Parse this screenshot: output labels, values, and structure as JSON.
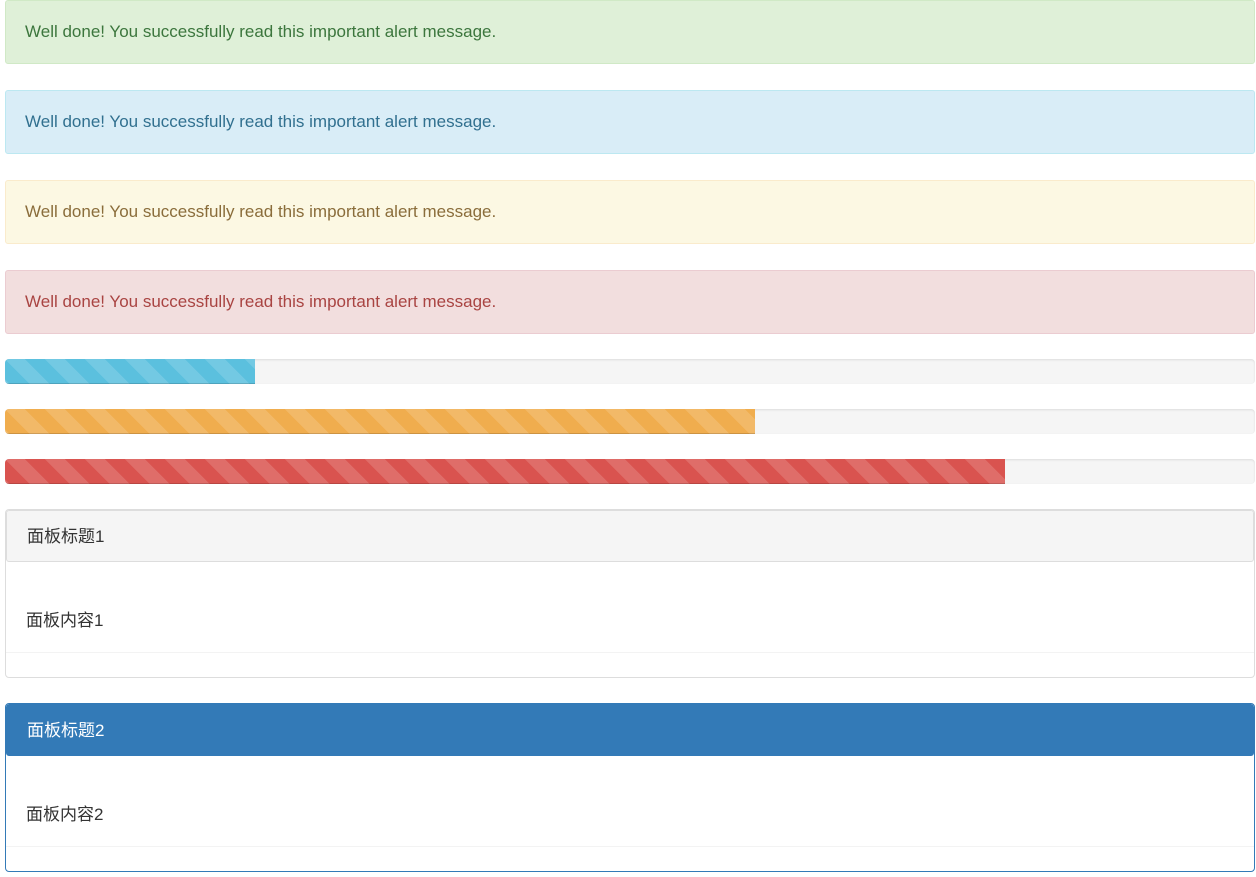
{
  "alerts": [
    {
      "type": "success",
      "text": "Well done! You successfully read this important alert message."
    },
    {
      "type": "info",
      "text": "Well done! You successfully read this important alert message."
    },
    {
      "type": "warning",
      "text": "Well done! You successfully read this important alert message."
    },
    {
      "type": "danger",
      "text": "Well done! You successfully read this important alert message."
    }
  ],
  "progress_bars": [
    {
      "type": "info",
      "value_fraction": 0.2,
      "color": "#5bc0de"
    },
    {
      "type": "warning",
      "value_fraction": 0.6,
      "color": "#f0ad4e"
    },
    {
      "type": "danger",
      "value_fraction": 0.8,
      "color": "#d9534f"
    }
  ],
  "panels": [
    {
      "style": "default",
      "title": "面板标题1",
      "content": "面板内容1"
    },
    {
      "style": "primary",
      "title": "面板标题2",
      "content": "面板内容2",
      "color": "#337ab7"
    }
  ],
  "colors": {
    "success_bg": "#dff0d8",
    "info_bg": "#d9edf7",
    "warning_bg": "#fcf8e3",
    "danger_bg": "#f2dede",
    "primary": "#337ab7"
  }
}
